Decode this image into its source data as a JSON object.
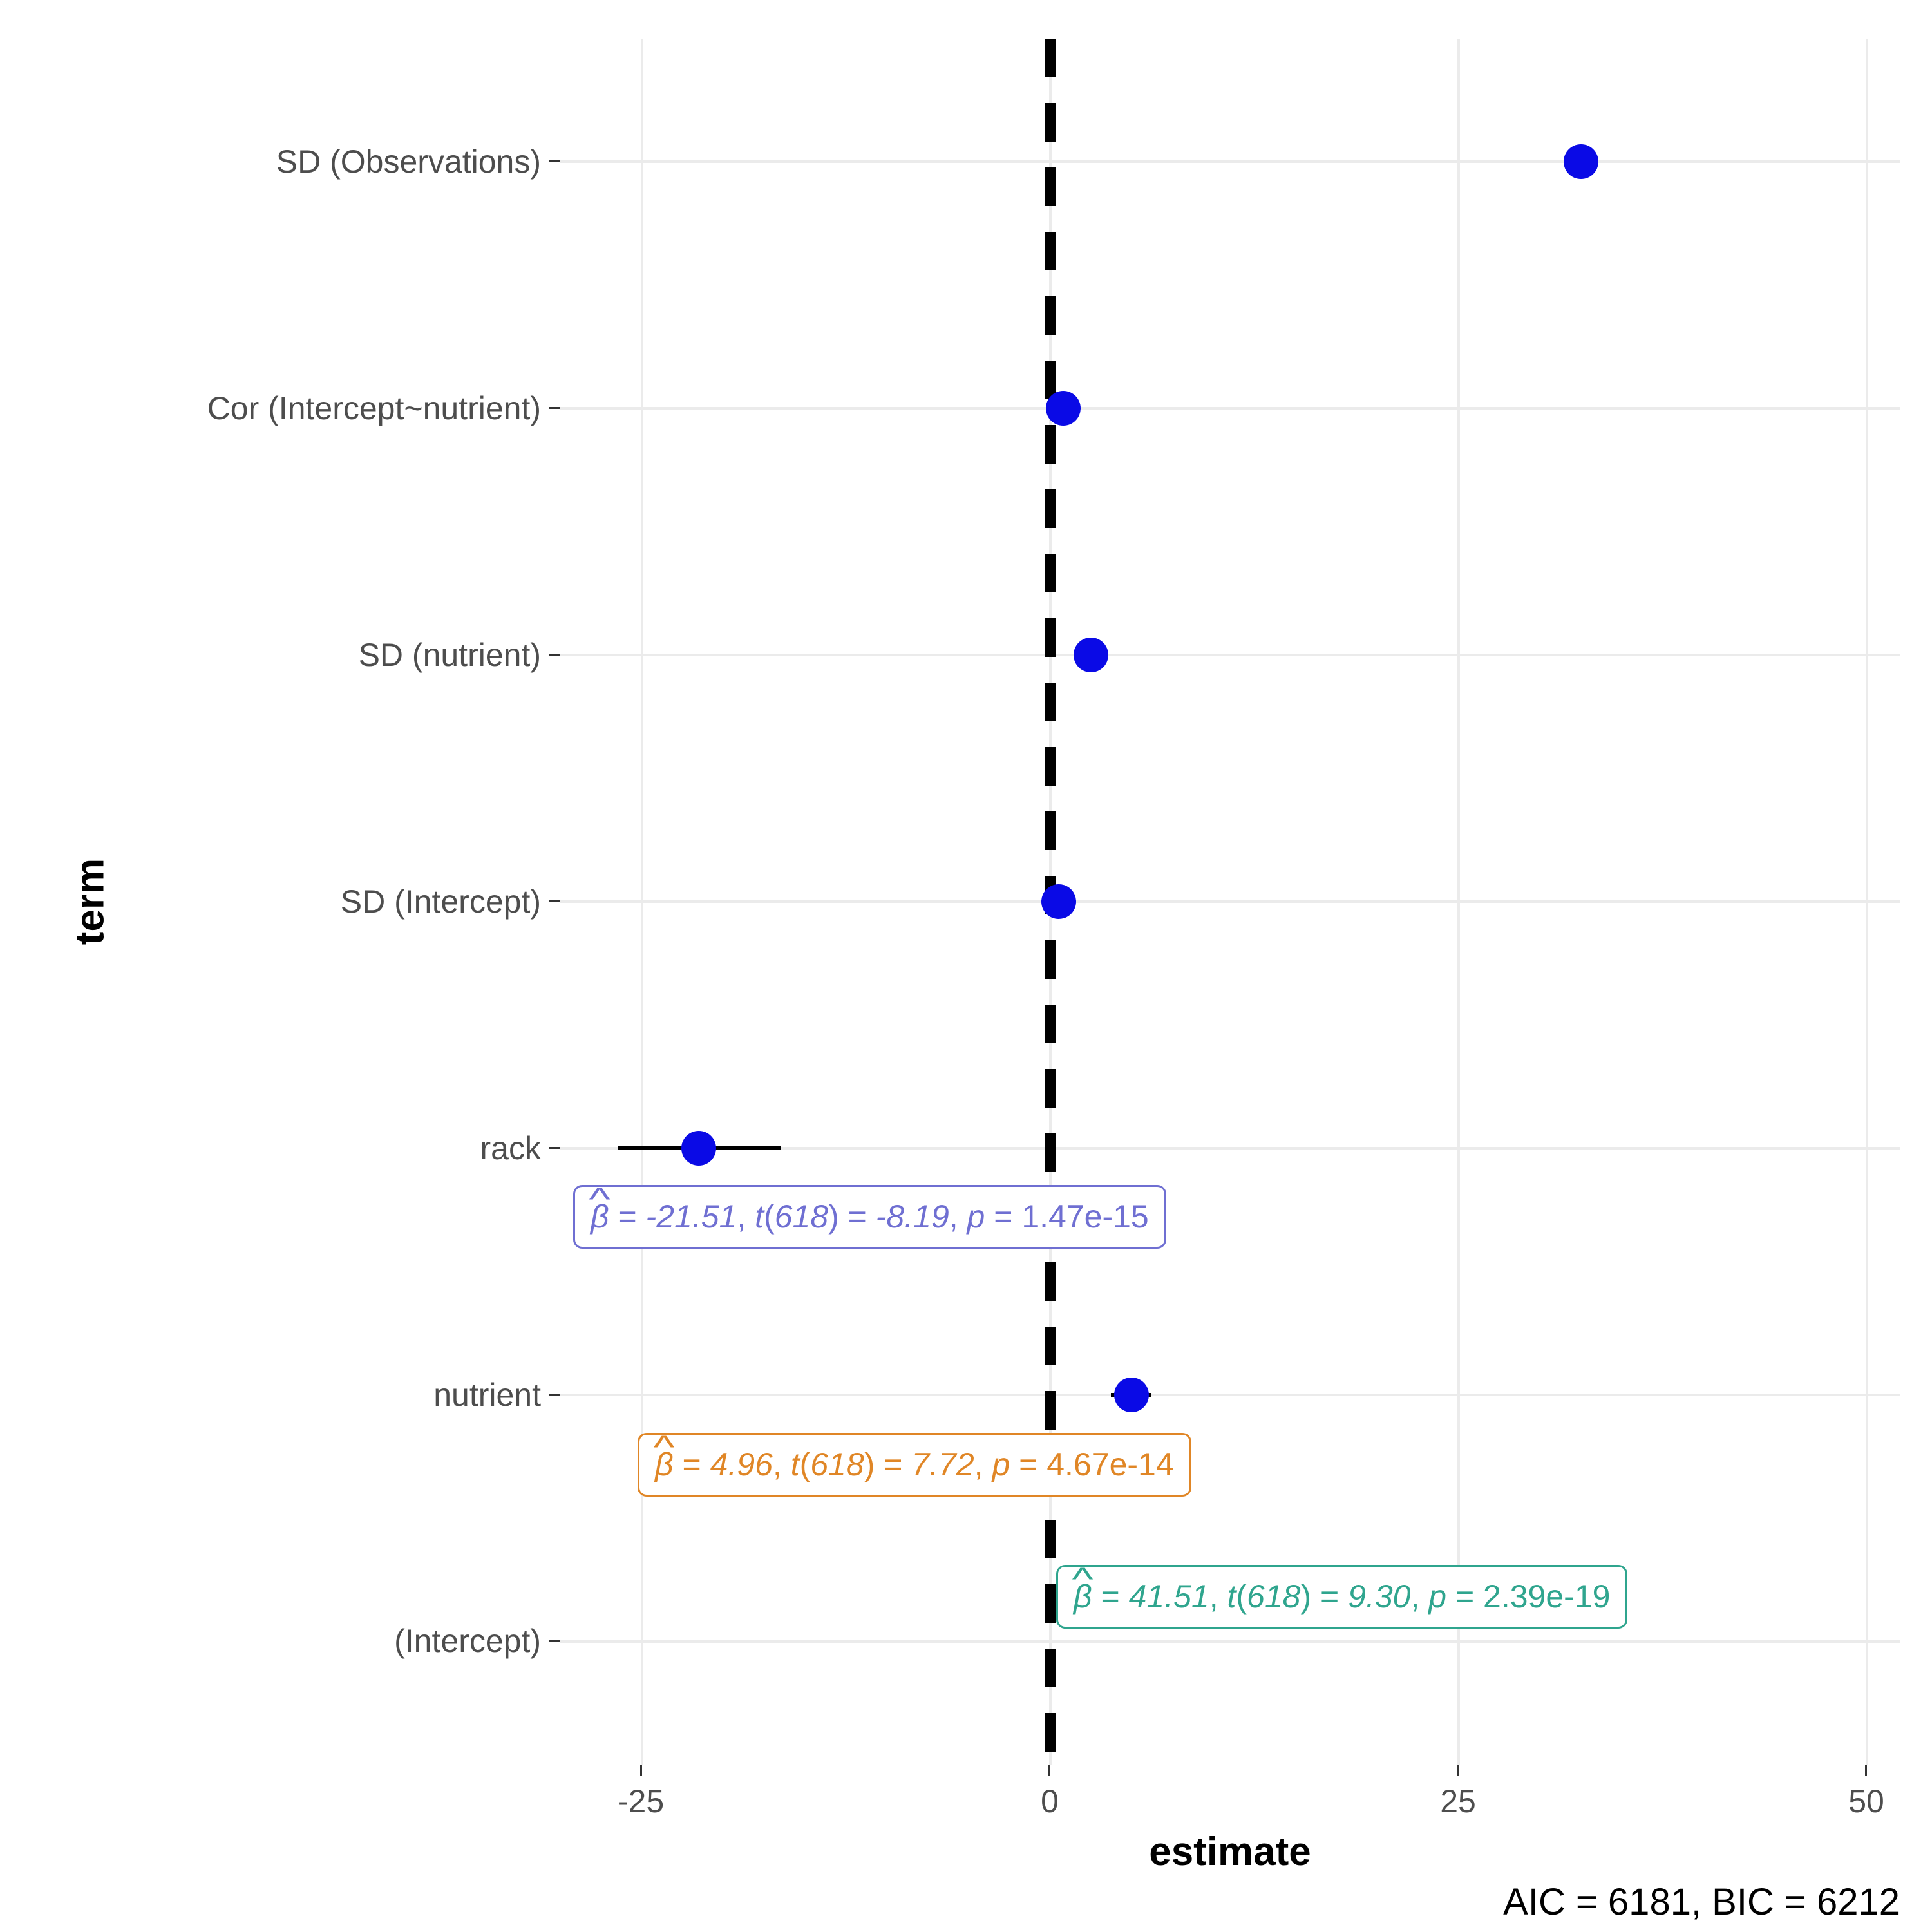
{
  "chart_data": {
    "type": "scatter",
    "xlabel": "estimate",
    "ylabel": "term",
    "xlim": [
      -30,
      52
    ],
    "x_ticks": [
      -25,
      0,
      25,
      50
    ],
    "categories": [
      "(Intercept)",
      "nutrient",
      "rack",
      "SD (Intercept)",
      "SD (nutrient)",
      "Cor (Intercept~nutrient)",
      "SD (Observations)"
    ],
    "series": [
      {
        "name": "estimate",
        "values": [
          41.51,
          4.96,
          -21.51,
          0.5,
          2.5,
          0.8,
          32.5
        ]
      }
    ],
    "error_bars": {
      "rack": {
        "low": -26.5,
        "high": -16.5
      },
      "nutrient": {
        "low": 3.7,
        "high": 6.2
      }
    },
    "annotations": [
      {
        "term": "rack",
        "text_plain": "beta_hat = -21.51, t(618) = -8.19, p = 1.47e-15",
        "beta": "-21.51",
        "df": "618",
        "t": "-8.19",
        "p": "1.47e-15",
        "color": "#6f6fd2"
      },
      {
        "term": "nutrient",
        "text_plain": "beta_hat = 4.96, t(618) = 7.72, p = 4.67e-14",
        "beta": "4.96",
        "df": "618",
        "t": "7.72",
        "p": "4.67e-14",
        "color": "#e08626"
      },
      {
        "term": "(Intercept)",
        "text_plain": "beta_hat = 41.51, t(618) = 9.30, p = 2.39e-19",
        "beta": "41.51",
        "df": "618",
        "t": "9.30",
        "p": "2.39e-19",
        "color": "#2fa58e"
      }
    ],
    "caption": "AIC = 6181, BIC = 6212"
  },
  "labels": {
    "x_m25": "-25",
    "x_0": "0",
    "x_25": "25",
    "x_50": "50",
    "y_intercept": "(Intercept)",
    "y_nutrient": "nutrient",
    "y_rack": "rack",
    "y_sd_int": "SD (Intercept)",
    "y_sd_nut": "SD (nutrient)",
    "y_cor": "Cor (Intercept~nutrient)",
    "y_sd_obs": "SD (Observations)",
    "xlabel": "estimate",
    "ylabel": "term",
    "caption": "AIC = 6181, BIC = 6212"
  },
  "annot": {
    "rack": {
      "beta": "-21.51",
      "df": "618",
      "t": "-8.19",
      "p": "1.47e-15"
    },
    "nutrient": {
      "beta": "4.96",
      "df": "618",
      "t": "7.72",
      "p": "4.67e-14"
    },
    "intercept": {
      "beta": "41.51",
      "df": "618",
      "t": "9.30",
      "p": "2.39e-19"
    }
  }
}
